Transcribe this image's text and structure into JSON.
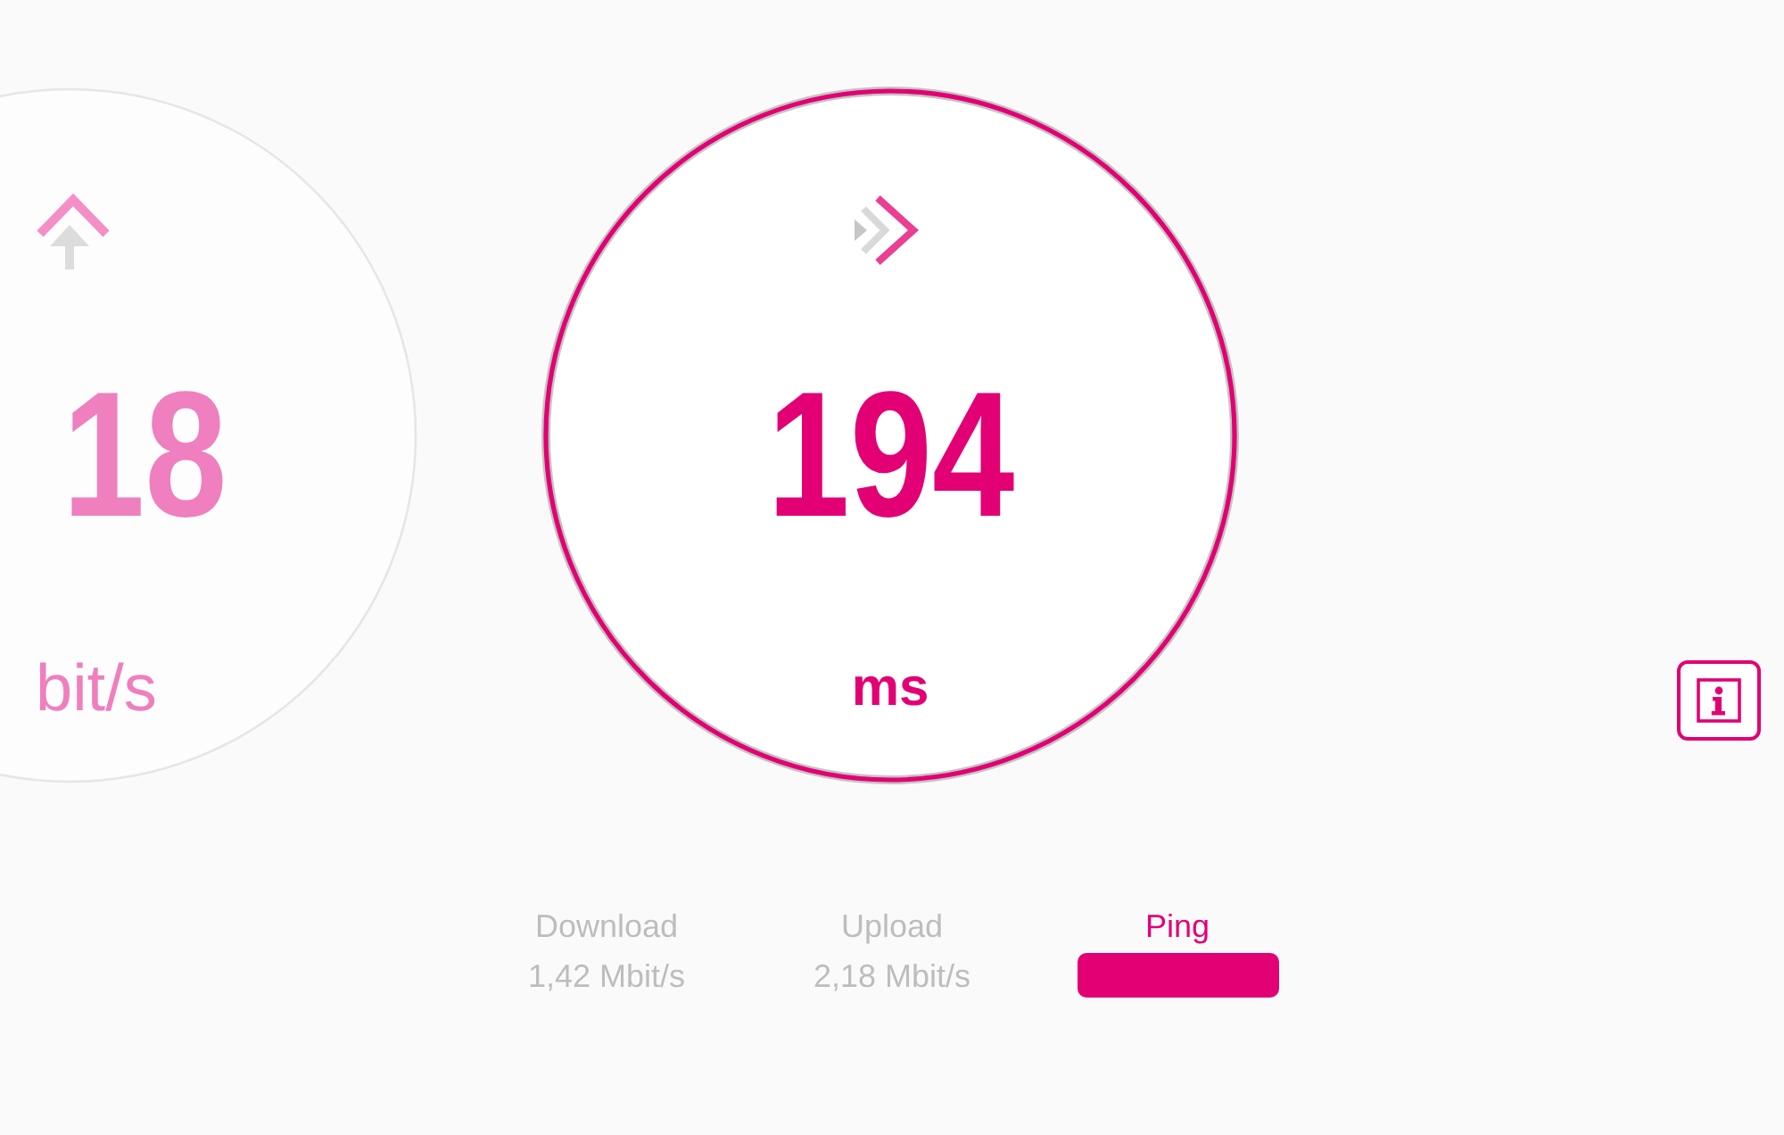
{
  "gauges": [
    {
      "kind": "upload",
      "value": "18",
      "unit": "bit/s",
      "selected": false
    },
    {
      "kind": "ping",
      "value": "194",
      "unit": "ms",
      "selected": true
    }
  ],
  "tabs": [
    {
      "label": "Download",
      "value": "1,42 Mbit/s",
      "selected": false
    },
    {
      "label": "Upload",
      "value": "2,18 Mbit/s",
      "selected": false
    },
    {
      "label": "Ping",
      "selected": true
    }
  ]
}
